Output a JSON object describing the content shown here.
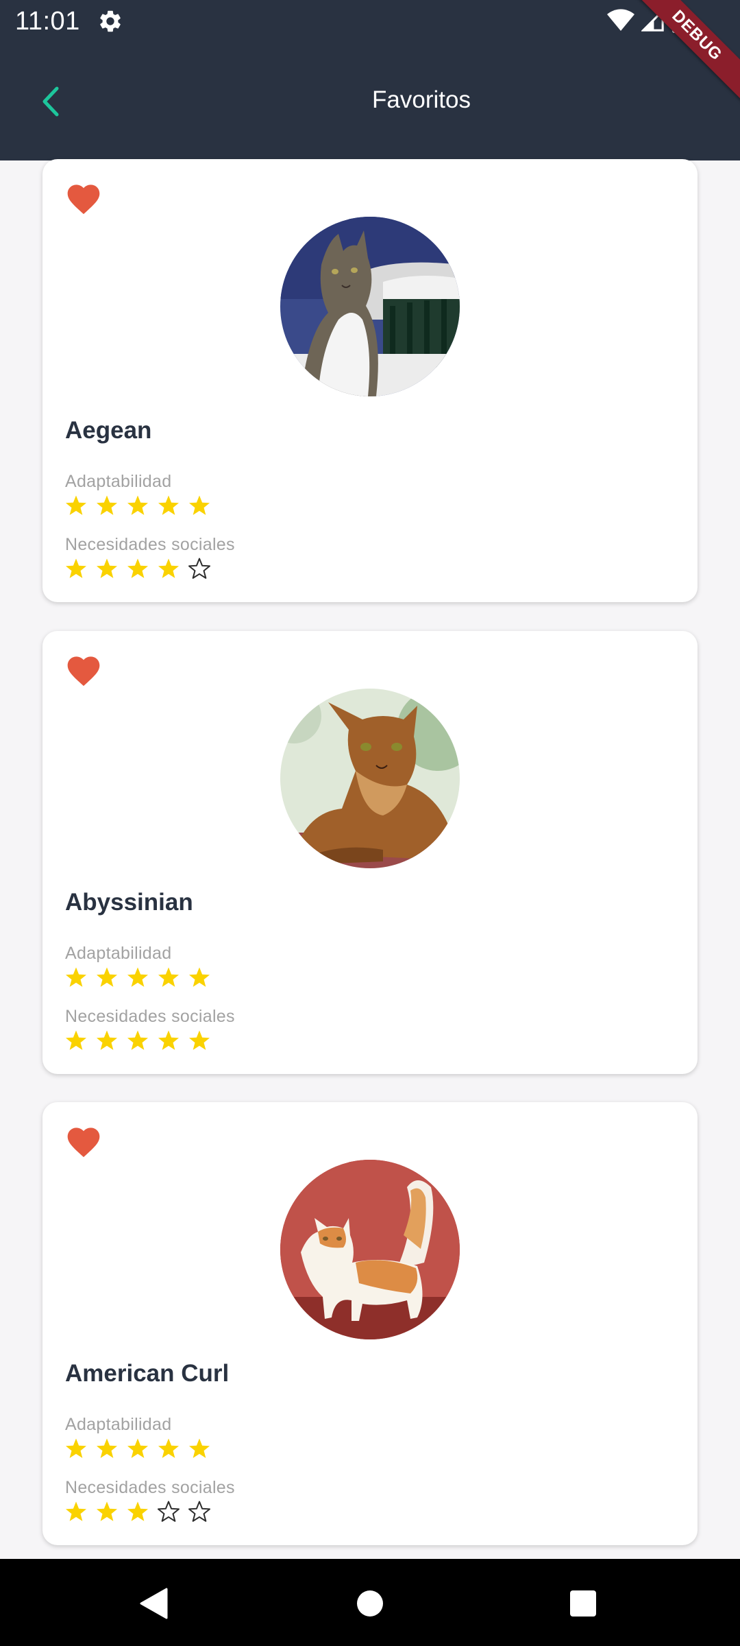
{
  "status_bar": {
    "time": "11:01",
    "icons": [
      "settings-icon",
      "wifi-icon",
      "signal-icon",
      "battery-icon"
    ],
    "debug_banner": "DEBUG"
  },
  "app_bar": {
    "title": "Favoritos",
    "back_icon": "chevron-left-icon",
    "accent_color": "#1dc69c",
    "background_color": "#293241"
  },
  "labels": {
    "adaptability": "Adaptabilidad",
    "social_needs": "Necesidades sociales"
  },
  "colors": {
    "heart": "#e4593f",
    "star": "#fad200",
    "star_empty_outline": "#2b2b2b",
    "name": "#293241"
  },
  "breeds": [
    {
      "name": "Aegean",
      "favorite": true,
      "adaptability_rating": 5,
      "social_needs_rating": 4,
      "max_rating": 5
    },
    {
      "name": "Abyssinian",
      "favorite": true,
      "adaptability_rating": 5,
      "social_needs_rating": 5,
      "max_rating": 5
    },
    {
      "name": "American Curl",
      "favorite": true,
      "adaptability_rating": 5,
      "social_needs_rating": 3,
      "max_rating": 5
    }
  ],
  "nav_bar": {
    "icons": [
      "back-triangle-icon",
      "home-circle-icon",
      "recents-square-icon"
    ]
  }
}
